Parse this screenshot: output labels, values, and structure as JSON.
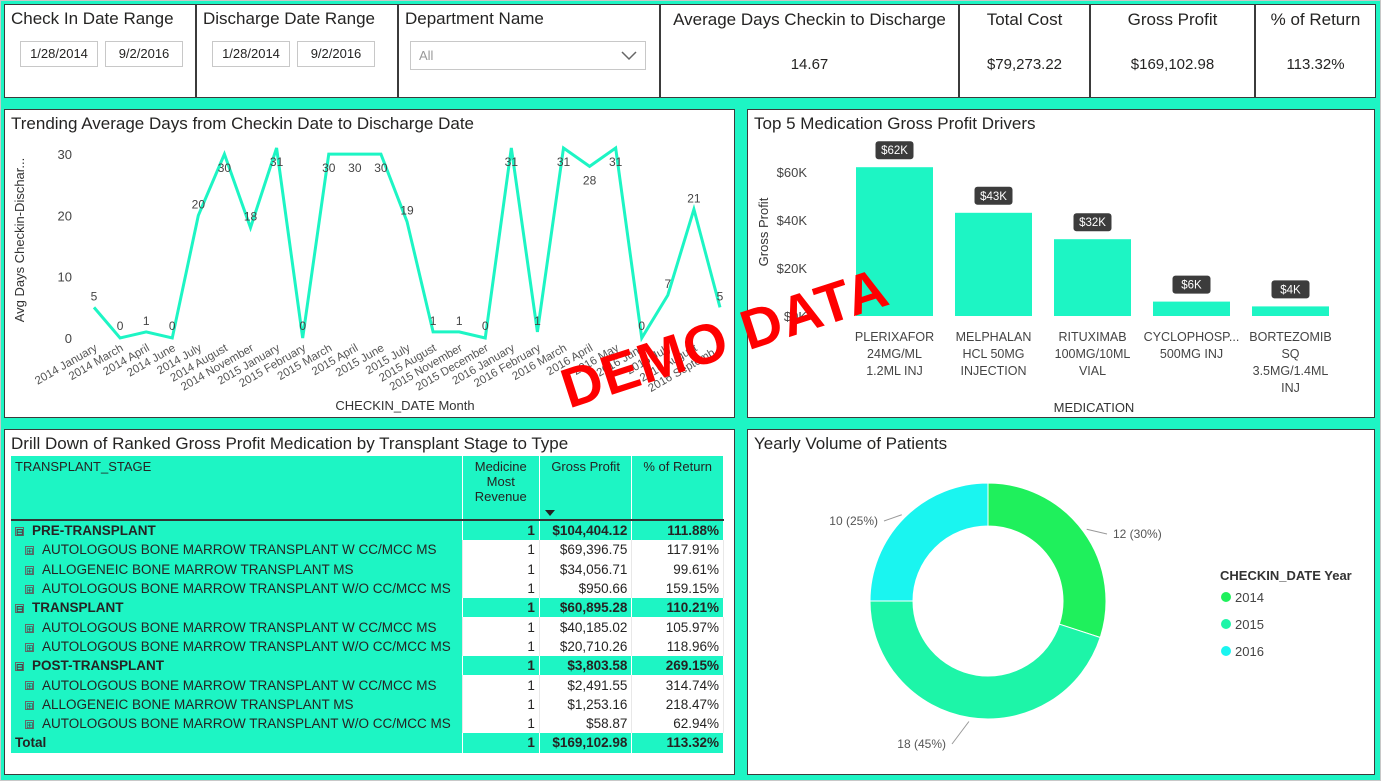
{
  "filters": {
    "checkin": {
      "title": "Check In Date Range",
      "start": "1/28/2014",
      "end": "9/2/2016"
    },
    "discharge": {
      "title": "Discharge Date Range",
      "start": "1/28/2014",
      "end": "9/2/2016"
    },
    "department": {
      "title": "Department Name",
      "selected": "All"
    }
  },
  "cards": {
    "avg_days": {
      "title": "Average Days Checkin to Discharge",
      "value": "14.67"
    },
    "total_cost": {
      "title": "Total Cost",
      "value": "$79,273.22"
    },
    "gross_profit": {
      "title": "Gross Profit",
      "value": "$169,102.98"
    },
    "pct_return": {
      "title": "% of Return",
      "value": "113.32%"
    }
  },
  "line_chart": {
    "title": "Trending Average Days from Checkin Date to Discharge Date",
    "ylabel": "Avg Days Checkin-Dischar...",
    "xlabel": "CHECKIN_DATE Month",
    "color": "#1df5c4"
  },
  "bar_chart": {
    "title": "Top 5 Medication Gross Profit Drivers",
    "ylabel": "Gross Profit",
    "xlabel": "MEDICATION",
    "color": "#1df5c4"
  },
  "donut_chart": {
    "title": "Yearly Volume of Patients",
    "legend_title": "CHECKIN_DATE Year"
  },
  "chart_data": [
    {
      "type": "line",
      "x": [
        "2014 January",
        "2014 March",
        "2014 April",
        "2014 June",
        "2014 July",
        "2014 August",
        "2014 November",
        "2015 January",
        "2015 February",
        "2015 March",
        "2015 April",
        "2015 June",
        "2015 July",
        "2015 August",
        "2015 November",
        "2015 December",
        "2016 January",
        "2016 February",
        "2016 March",
        "2016 April",
        "2016 May",
        "2016 June",
        "2016 July",
        "2016 August",
        "2016 Septemb..."
      ],
      "values": [
        5,
        0,
        1,
        0,
        20,
        30,
        18,
        31,
        0,
        30,
        30,
        30,
        19,
        1,
        1,
        0,
        31,
        1,
        31,
        28,
        31,
        0,
        7,
        21,
        5
      ],
      "labels": [
        "5",
        "0",
        "1",
        "0",
        "20",
        "30",
        "18",
        "31",
        "0",
        "30",
        "30",
        "30",
        "19",
        "1",
        "1",
        "0",
        "31",
        "1",
        "31",
        "28",
        "31",
        "0",
        "7",
        "21",
        "5"
      ],
      "yticks": [
        "0",
        "10",
        "20",
        "30"
      ],
      "ylim": [
        0,
        32
      ]
    },
    {
      "type": "bar",
      "categories": [
        [
          "PLERIXAFOR",
          "24MG/ML",
          "1.2ML INJ"
        ],
        [
          "MELPHALAN",
          "HCL 50MG",
          "INJECTION"
        ],
        [
          "RITUXIMAB",
          "100MG/10ML",
          "VIAL"
        ],
        [
          "CYCLOPHOSP...",
          "500MG INJ"
        ],
        [
          "BORTEZOMIB",
          "SQ",
          "3.5MG/1.4ML",
          "INJ"
        ]
      ],
      "values": [
        62,
        43,
        32,
        6,
        4
      ],
      "data_labels": [
        "$62K",
        "$43K",
        "$32K",
        "$6K",
        "$4K"
      ],
      "yticks": [
        "$0K",
        "$20K",
        "$40K",
        "$60K"
      ],
      "ylim": [
        0,
        70
      ]
    },
    {
      "type": "pie",
      "categories": [
        "2014",
        "2015",
        "2016"
      ],
      "values": [
        12,
        18,
        10
      ],
      "labels": [
        "12 (30%)",
        "18 (45%)",
        "10 (25%)"
      ],
      "colors": [
        "#1ff05c",
        "#1df5a8",
        "#1af5f0"
      ]
    }
  ],
  "matrix": {
    "title": "Drill Down of Ranked Gross Profit Medication by Transplant Stage to Type",
    "headers": [
      "TRANSPLANT_STAGE",
      "Medicine Most Revenue",
      "Gross Profit",
      "% of Return"
    ],
    "rows": [
      {
        "kind": "group",
        "expander": "⊟",
        "name": "PRE-TRANSPLANT",
        "count": "1",
        "profit": "$104,404.12",
        "ret": "111.88%"
      },
      {
        "kind": "row",
        "expander": "⊞",
        "name": "AUTOLOGOUS BONE MARROW TRANSPLANT W CC/MCC MS",
        "count": "1",
        "profit": "$69,396.75",
        "ret": "117.91%"
      },
      {
        "kind": "row",
        "expander": "⊞",
        "name": "ALLOGENEIC BONE MARROW TRANSPLANT MS",
        "count": "1",
        "profit": "$34,056.71",
        "ret": "99.61%"
      },
      {
        "kind": "row",
        "expander": "⊞",
        "name": "AUTOLOGOUS BONE MARROW TRANSPLANT W/O CC/MCC MS",
        "count": "1",
        "profit": "$950.66",
        "ret": "159.15%"
      },
      {
        "kind": "group",
        "expander": "⊟",
        "name": "TRANSPLANT",
        "count": "1",
        "profit": "$60,895.28",
        "ret": "110.21%"
      },
      {
        "kind": "row",
        "expander": "⊞",
        "name": "AUTOLOGOUS BONE MARROW TRANSPLANT W CC/MCC MS",
        "count": "1",
        "profit": "$40,185.02",
        "ret": "105.97%"
      },
      {
        "kind": "row",
        "expander": "⊞",
        "name": "AUTOLOGOUS BONE MARROW TRANSPLANT W/O CC/MCC MS",
        "count": "1",
        "profit": "$20,710.26",
        "ret": "118.96%"
      },
      {
        "kind": "group",
        "expander": "⊟",
        "name": "POST-TRANSPLANT",
        "count": "1",
        "profit": "$3,803.58",
        "ret": "269.15%"
      },
      {
        "kind": "row",
        "expander": "⊞",
        "name": "AUTOLOGOUS BONE MARROW TRANSPLANT W CC/MCC MS",
        "count": "1",
        "profit": "$2,491.55",
        "ret": "314.74%"
      },
      {
        "kind": "row",
        "expander": "⊞",
        "name": "ALLOGENEIC BONE MARROW TRANSPLANT MS",
        "count": "1",
        "profit": "$1,253.16",
        "ret": "218.47%"
      },
      {
        "kind": "row",
        "expander": "⊞",
        "name": "AUTOLOGOUS BONE MARROW TRANSPLANT W/O CC/MCC MS",
        "count": "1",
        "profit": "$58.87",
        "ret": "62.94%"
      },
      {
        "kind": "total",
        "expander": "",
        "name": "Total",
        "count": "1",
        "profit": "$169,102.98",
        "ret": "113.32%"
      }
    ]
  },
  "watermark": "DEMO DATA"
}
